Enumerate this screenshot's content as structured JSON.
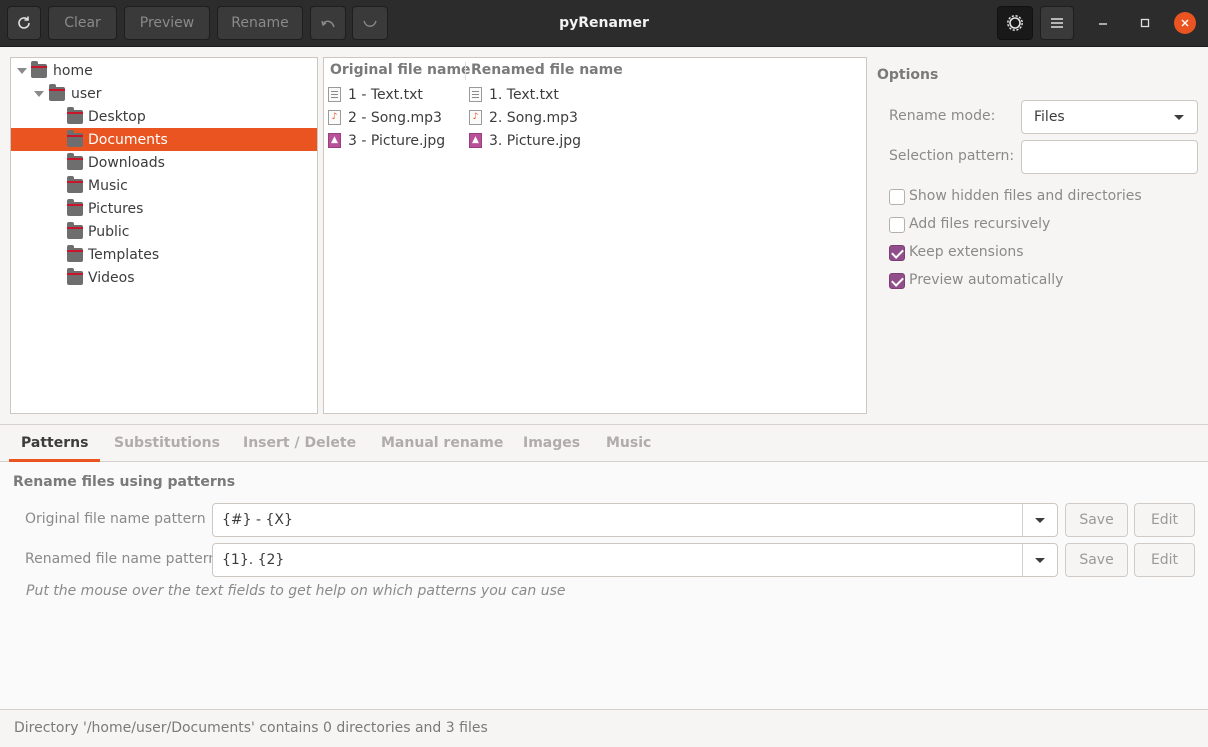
{
  "window": {
    "title": "pyRenamer",
    "toolbar": {
      "clear_label": "Clear",
      "preview_label": "Preview",
      "rename_label": "Rename"
    }
  },
  "tree": {
    "items": [
      {
        "label": "home"
      },
      {
        "label": "user"
      },
      {
        "label": "Desktop"
      },
      {
        "label": "Documents"
      },
      {
        "label": "Downloads"
      },
      {
        "label": "Music"
      },
      {
        "label": "Pictures"
      },
      {
        "label": "Public"
      },
      {
        "label": "Templates"
      },
      {
        "label": "Videos"
      }
    ],
    "selected": "Documents"
  },
  "files": {
    "headers": {
      "original": "Original file name",
      "renamed": "Renamed file name"
    },
    "rows": [
      {
        "original": "1 - Text.txt",
        "renamed": "1. Text.txt",
        "icon": "text-file-icon"
      },
      {
        "original": "2 - Song.mp3",
        "renamed": "2. Song.mp3",
        "icon": "audio-file-icon"
      },
      {
        "original": "3 - Picture.jpg",
        "renamed": "3. Picture.jpg",
        "icon": "image-file-icon"
      }
    ]
  },
  "options": {
    "heading": "Options",
    "rename_mode_label": "Rename mode:",
    "rename_mode_value": "Files",
    "selection_pattern_label": "Selection pattern:",
    "selection_pattern_value": "",
    "checks": [
      {
        "label": "Show hidden files and directories",
        "checked": false
      },
      {
        "label": "Add files recursively",
        "checked": false
      },
      {
        "label": "Keep extensions",
        "checked": true
      },
      {
        "label": "Preview automatically",
        "checked": true
      }
    ]
  },
  "tabs": [
    {
      "label": "Patterns"
    },
    {
      "label": "Substitutions"
    },
    {
      "label": "Insert / Delete"
    },
    {
      "label": "Manual rename"
    },
    {
      "label": "Images"
    },
    {
      "label": "Music"
    }
  ],
  "patterns": {
    "heading": "Rename files using patterns",
    "original_label": "Original file name pattern",
    "original_value": "{#} - {X}",
    "renamed_label": "Renamed file name pattern",
    "renamed_value": "{1}. {2}",
    "save_label": "Save",
    "edit_label": "Edit",
    "hint": "Put the mouse over the text fields to get help on which patterns you can use"
  },
  "status": "Directory '/home/user/Documents' contains 0 directories and 3 files",
  "colors": {
    "accent": "#e95420",
    "check": "#924d8b",
    "titlebar": "#2c2c2c"
  }
}
